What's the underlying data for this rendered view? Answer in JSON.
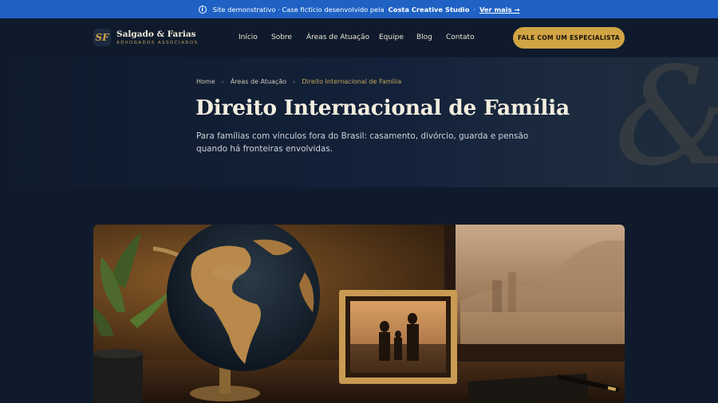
{
  "banner": {
    "text_prefix": "Site demonstrativo · Case fictício desenvolvido pela",
    "studio": "Costa Creative Studio",
    "separator": "·",
    "more": "Ver mais →"
  },
  "brand": {
    "mark": "SF",
    "name": "Salgado & Farias",
    "subtitle": "ADVOGADOS ASSOCIADOS"
  },
  "nav": [
    "Início",
    "Sobre",
    "Áreas de Atuação",
    "Equipe",
    "Blog",
    "Contato"
  ],
  "cta": "FALE COM UM ESPECIALISTA",
  "breadcrumb": {
    "home": "Home",
    "section": "Áreas de Atuação",
    "current": "Direito Internacional de Família"
  },
  "hero": {
    "title": "Direito Internacional de Família",
    "description": "Para famílias com vínculos fora do Brasil: casamento, divórcio, guarda e pensão quando há fronteiras envolvidas.",
    "decoration": "&"
  },
  "colors": {
    "banner": "#1f62c4",
    "background": "#0f1b2c",
    "accent_gold": "#d1a444"
  },
  "photo": {
    "subject": "globe-frame-desk-photo"
  }
}
